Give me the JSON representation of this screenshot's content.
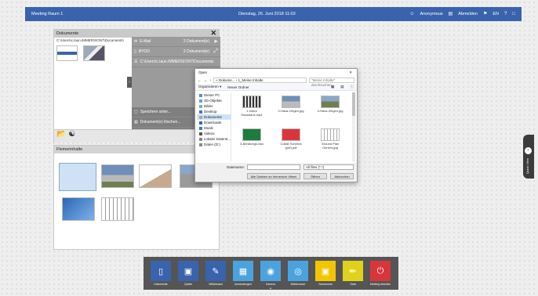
{
  "topbar": {
    "title": "Meeting Raum 1",
    "datetime": "Dienstag, 26. Juni 2018  11:03",
    "user": "Anonymous",
    "logout": "Abmelden",
    "language": "EN",
    "user_icon": "user-icon",
    "logout_icon": "logout-icon"
  },
  "documents": {
    "title": "Dokumente",
    "path": "C:\\Users\\c.laun.IMMERSION7\\Documents\\",
    "menu": {
      "email_label": "E-Mail",
      "email_count": "2 Dokument(e)",
      "byod_label": "BYOD",
      "byod_count": "2 Dokument(e)",
      "path_label": "C:\\Users\\c.laun.IMMERSION7\\Documents",
      "save_label": "Speichern unter...",
      "delete_label": "Dokument(e) löschen..."
    }
  },
  "flem": {
    "title": "Flemerinhalte"
  },
  "dialog": {
    "title": "Open",
    "breadcrumb": "« Dokume... › 1_Meine Inhalte",
    "search_placeholder": "\"Meine Inhalte\" durchsuchen",
    "organize": "Organisieren ▾",
    "new_folder": "Neuer Ordner",
    "nav": [
      "Dieser PC",
      "3D-Objekte",
      "Bilder",
      "Desktop",
      "Dokumente",
      "Downloads",
      "Musik",
      "Videos",
      "Lokaler Datentr...",
      "Daten (D:)"
    ],
    "files": [
      {
        "name": "1-Video Hausbaus.mp4"
      },
      {
        "name": "2-Haus-1Ihgen.jpg"
      },
      {
        "name": "3-Haus-2Ihgen.jpg"
      },
      {
        "name": "4-Beratungs.xlsx"
      },
      {
        "name": "Collab Schema (pdf).pdf"
      },
      {
        "name": "Ground Plan Genera.jpg"
      }
    ],
    "filename_label": "Dateiname:",
    "filter": "All files (*.*)",
    "open_btn": "Öffnen",
    "cancel_btn": "Abbrechen",
    "extra_btn": "Alle Dateien an Immersive öffnen"
  },
  "quickbar": {
    "items": [
      {
        "label": "Dokumente",
        "color": "#3a63ad",
        "icon": "document-icon"
      },
      {
        "label": "Quelle",
        "color": "#3a63ad",
        "icon": "source-icon"
      },
      {
        "label": "Whiteboard",
        "color": "#3a63ad",
        "icon": "whiteboard-icon"
      },
      {
        "label": "Anwendungen",
        "color": "#4aa3df",
        "icon": "apps-icon"
      },
      {
        "label": "Kamera",
        "color": "#4aa3df",
        "icon": "camera-icon"
      },
      {
        "label": "Webbrowser",
        "color": "#4aa3df",
        "icon": "globe-icon"
      },
      {
        "label": "Screenshot",
        "color": "#f2c500",
        "icon": "screenshot-icon"
      },
      {
        "label": "Tools",
        "color": "#e0d21a",
        "icon": "tools-icon"
      },
      {
        "label": "Meeting beenden",
        "color": "#d9363b",
        "icon": "power-icon"
      }
    ]
  },
  "quickview": {
    "label": "Quick View"
  }
}
